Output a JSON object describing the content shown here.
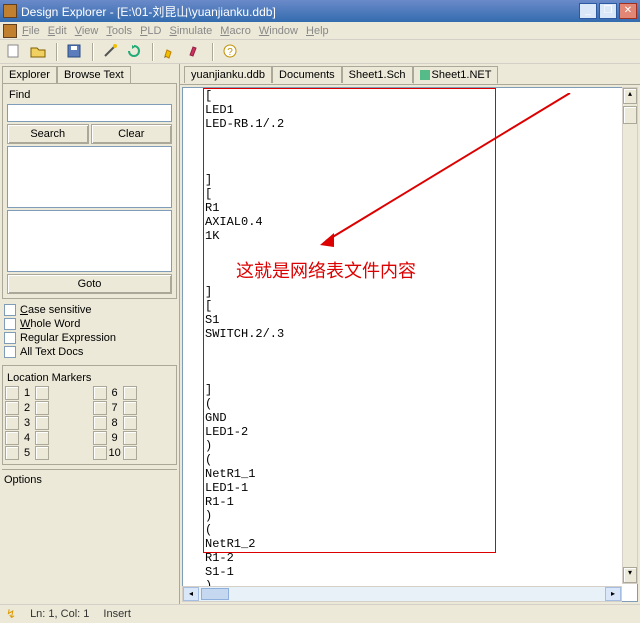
{
  "title": "Design Explorer - [E:\\01-刘昆山\\yuanjianku.ddb]",
  "menu": {
    "file": "File",
    "edit": "Edit",
    "view": "View",
    "tools": "Tools",
    "pld": "PLD",
    "simulate": "Simulate",
    "macro": "Macro",
    "window": "Window",
    "help": "Help"
  },
  "left": {
    "tabs": {
      "explorer": "Explorer",
      "browse": "Browse Text"
    },
    "find": "Find",
    "search": "Search",
    "clear": "Clear",
    "goto": "Goto",
    "chk": {
      "case": "Case sensitive",
      "whole": "Whole Word",
      "regex": "Regular Expression",
      "all": "All Text Docs"
    },
    "markers_title": "Location Markers",
    "markers": [
      "1",
      "2",
      "3",
      "4",
      "5",
      "6",
      "7",
      "8",
      "9",
      "10"
    ],
    "options": "Options"
  },
  "doctabs": {
    "t1": "yuanjianku.ddb",
    "t2": "Documents",
    "t3": "Sheet1.Sch",
    "t4": "Sheet1.NET"
  },
  "editor_text": "[\nLED1\nLED-RB.1/.2\n\n\n\n]\n[\nR1\nAXIAL0.4\n1K\n\n\n\n]\n[\nS1\nSWITCH.2/.3\n\n\n\n]\n(\nGND\nLED1-2\n)\n(\nNetR1_1\nLED1-1\nR1-1\n)\n(\nNetR1_2\nR1-2\nS1-1\n)\n(\nVCC",
  "annotation": "这就是网络表文件内容",
  "status": {
    "pos": "Ln: 1, Col:  1",
    "mode": "Insert"
  }
}
